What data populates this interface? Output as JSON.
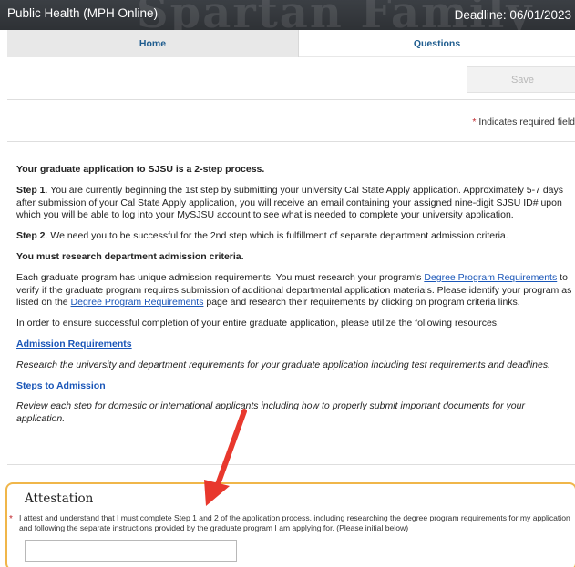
{
  "header": {
    "program": "Public Health (MPH Online)",
    "deadline": "Deadline: 06/01/2023",
    "background_text": "Spartan Family"
  },
  "tabs": [
    {
      "label": "Home"
    },
    {
      "label": "Questions"
    }
  ],
  "toolbar": {
    "save_label": "Save"
  },
  "required_note": {
    "star": "*",
    "text": " Indicates required field"
  },
  "content": {
    "intro": "Your graduate application to SJSU is a 2-step process.",
    "step1_label": "Step 1",
    "step1_text": ". You are currently beginning the 1st step by submitting your university Cal State Apply application. Approximately 5-7 days after submission of your Cal State Apply application, you will receive an email containing your assigned nine-digit SJSU ID# upon which you will be able to log into your MySJSU account to see what is needed to complete your university application.",
    "step2_label": "Step 2",
    "step2_text": ". We need you to be successful for the 2nd step which is fulfillment of separate department admission criteria.",
    "research_heading": "You must research department admission criteria.",
    "requirements_p1": "Each graduate program has unique admission requirements. You must research your program's ",
    "requirements_link1": "Degree Program Requirements",
    "requirements_p2": " to verify if the graduate program requires submission of additional departmental application materials. Please identify your program as listed on the ",
    "requirements_link2": "Degree Program Requirements",
    "requirements_p3": " page and research their requirements by clicking on program criteria links.",
    "resources_intro": "In order to ensure successful completion of your entire graduate application, please utilize the following resources.",
    "admission_link": "Admission Requirements",
    "admission_desc": "Research the university and department requirements for your graduate application including test requirements and deadlines.",
    "steps_link": "Steps to Admission",
    "steps_desc": "Review each step for domestic or international applicants including how to properly submit important documents for your application."
  },
  "attestation": {
    "title": "Attestation",
    "star": "*",
    "text": "I attest and understand that I must complete Step 1 and 2 of the application process, including researching the degree program requirements for my application and following the separate instructions provided by the graduate program I am applying for. (Please initial below)",
    "input_value": ""
  },
  "colors": {
    "header_bg": "#2e3135",
    "tab_text": "#1e5c8e",
    "link": "#1a56b8",
    "required_star": "#c1272d",
    "attest_border": "#f0b64a",
    "annotation_arrow": "#e8382d"
  }
}
